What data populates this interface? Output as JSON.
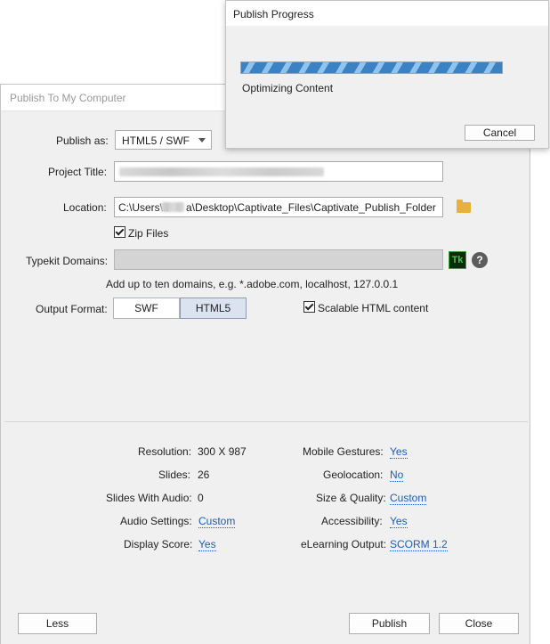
{
  "main_dialog": {
    "title": "Publish To My Computer",
    "publish_as": {
      "label": "Publish as:",
      "value": "HTML5 / SWF"
    },
    "project_title": {
      "label": "Project Title:"
    },
    "location": {
      "label": "Location:",
      "value": "C:\\Users\\k",
      "value_suffix": "a\\Desktop\\Captivate_Files\\Captivate_Publish_Folder"
    },
    "zip_files": {
      "label": "Zip Files",
      "checked": true
    },
    "typekit": {
      "label": "Typekit Domains:",
      "icon_text": "Tk",
      "help_text": "?",
      "hint": "Add up to ten domains, e.g. *.adobe.com, localhost, 127.0.0.1"
    },
    "output_format": {
      "label": "Output Format:",
      "options": [
        "SWF",
        "HTML5"
      ],
      "selected": "HTML5"
    },
    "scalable": {
      "label": "Scalable HTML content",
      "checked": true
    },
    "details_left": [
      {
        "label": "Resolution:",
        "value": "300 X 987",
        "is_link": false
      },
      {
        "label": "Slides:",
        "value": "26",
        "is_link": false
      },
      {
        "label": "Slides With Audio:",
        "value": "0",
        "is_link": false
      },
      {
        "label": "Audio Settings:",
        "value": "Custom",
        "is_link": true
      },
      {
        "label": "Display Score:",
        "value": "Yes",
        "is_link": true
      }
    ],
    "details_right": [
      {
        "label": "Mobile Gestures:",
        "value": "Yes"
      },
      {
        "label": "Geolocation:",
        "value": "No"
      },
      {
        "label": "Size & Quality:",
        "value": "Custom"
      },
      {
        "label": "Accessibility:",
        "value": "Yes"
      },
      {
        "label": "eLearning Output:",
        "value": "SCORM 1.2"
      }
    ],
    "buttons": {
      "less": "Less",
      "publish": "Publish",
      "close": "Close"
    }
  },
  "progress_dialog": {
    "title": "Publish Progress",
    "status": "Optimizing Content",
    "progress_percent": 100,
    "cancel": "Cancel"
  },
  "colors": {
    "link": "#1a5fb4",
    "progress": "#3a82c4",
    "folder": "#e8b23a",
    "dialog_bg": "#f0f0f0"
  }
}
